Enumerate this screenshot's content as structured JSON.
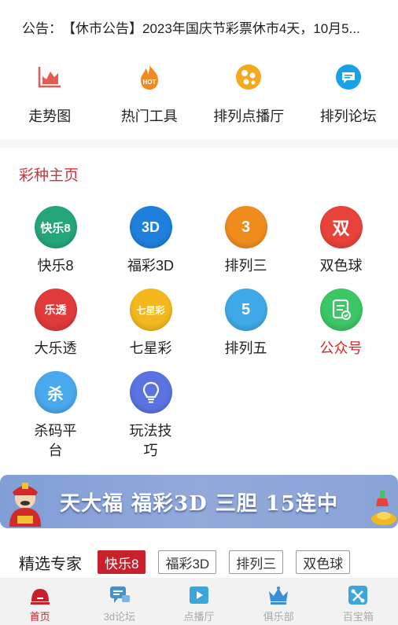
{
  "notice": {
    "label": "公告：",
    "text": "【休市公告】2023年国庆节彩票休市4天，10月5..."
  },
  "quick_links": [
    {
      "label": "走势图",
      "icon": "trend-chart-icon"
    },
    {
      "label": "热门工具",
      "icon": "hot-fire-icon"
    },
    {
      "label": "排列点播厅",
      "icon": "broadcast-icon"
    },
    {
      "label": "排列论坛",
      "icon": "forum-chat-icon"
    }
  ],
  "section_title": "彩种主页",
  "lotteries": [
    {
      "label": "快乐8",
      "badge": "快乐8",
      "color": "#24a67a"
    },
    {
      "label": "福彩3D",
      "badge": "3D",
      "color": "#1e7fdc"
    },
    {
      "label": "排列三",
      "badge": "3",
      "color": "#f08c1e"
    },
    {
      "label": "双色球",
      "badge": "双",
      "color": "#e8433a"
    },
    {
      "label": "大乐透",
      "badge": "乐透",
      "color": "#e03a3a"
    },
    {
      "label": "七星彩",
      "badge": "七星彩",
      "color": "#f3b81e"
    },
    {
      "label": "排列五",
      "badge": "5",
      "color": "#3fa9e8"
    },
    {
      "label": "公众号",
      "badge": "",
      "color": "#3cc665"
    },
    {
      "label": "杀码平台",
      "badge": "杀",
      "color": "#4aa8ec"
    },
    {
      "label": "玩法技巧",
      "badge": "",
      "color": "#5a73e0"
    }
  ],
  "banner": {
    "text": "天大福 福彩3D 三胆 15连中"
  },
  "experts": {
    "title": "精选专家",
    "tabs": [
      "快乐8",
      "福彩3D",
      "排列三",
      "双色球"
    ],
    "active": "快乐8"
  },
  "tabbar": [
    {
      "label": "首页",
      "icon": "home-icon",
      "active": true
    },
    {
      "label": "3d论坛",
      "icon": "forum-icon",
      "active": false
    },
    {
      "label": "点播厅",
      "icon": "play-icon",
      "active": false
    },
    {
      "label": "俱乐部",
      "icon": "crown-icon",
      "active": false
    },
    {
      "label": "百宝箱",
      "icon": "toolbox-icon",
      "active": false
    }
  ],
  "colors": {
    "accent": "#c8212b",
    "section_title": "#c8343b",
    "tab_inactive": "#aaaaaa"
  }
}
